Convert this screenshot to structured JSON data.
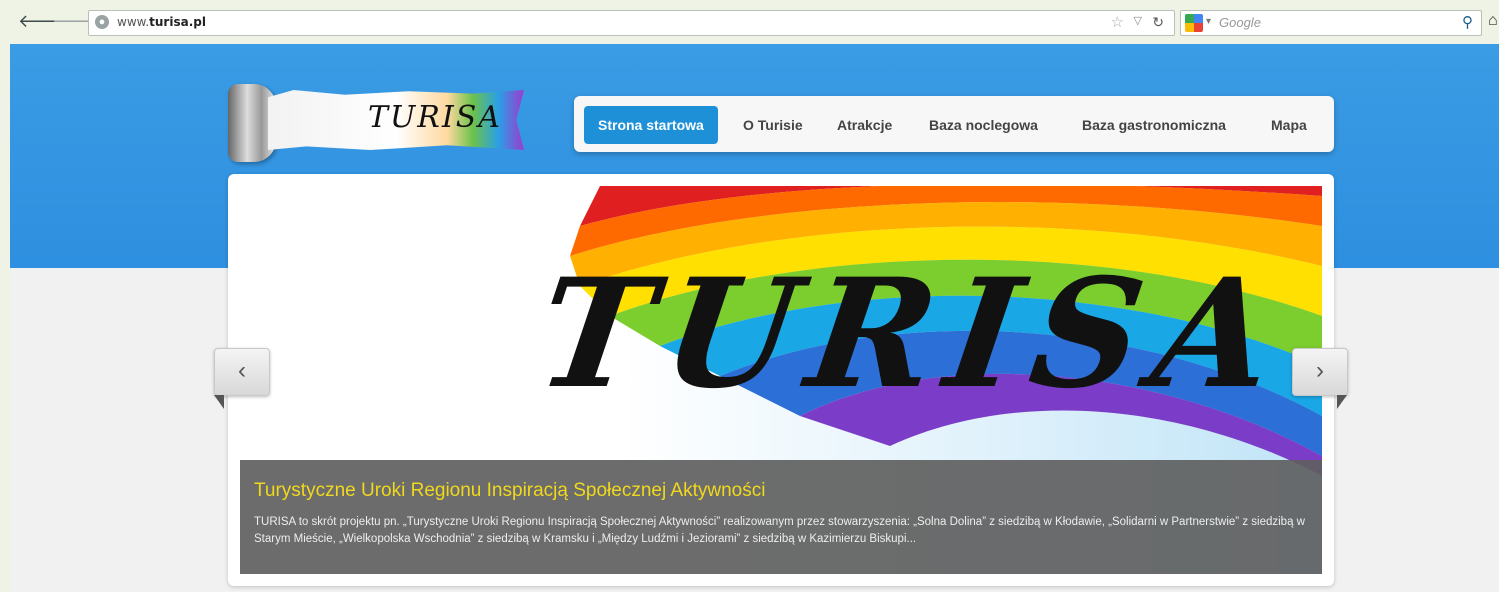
{
  "browser": {
    "url_prefix": "www.",
    "url_domain": "turisa.pl",
    "search_placeholder": "Google",
    "back_glyph": "🡐",
    "forward_glyph": "🡒"
  },
  "site": {
    "logo_text": "TURISA",
    "menu": [
      {
        "label": "Strona startowa",
        "active": true
      },
      {
        "label": "O Turisie",
        "active": false
      },
      {
        "label": "Atrakcje",
        "active": false
      },
      {
        "label": "Baza noclegowa",
        "active": false
      },
      {
        "label": "Baza gastronomiczna",
        "active": false
      },
      {
        "label": "Mapa",
        "active": false
      }
    ]
  },
  "slider": {
    "art_text": "TURISA",
    "caption_title": "Turystyczne Uroki Regionu Inspiracją Społecznej Aktywności",
    "caption_text": "TURISA to skrót projektu pn. „Turystyczne Uroki Regionu Inspiracją Społecznej Aktywności” realizowanym przez stowarzyszenia: „Solna Dolina” z siedzibą w Kłodawie, „Solidarni w Partnerstwie” z siedzibą w Starym Mieście, „Wielkopolska Wschodnia” z siedzibą w Kramsku i „Między Ludźmi i Jeziorami” z siedzibą w Kazimierzu Biskupi...",
    "prev_glyph": "‹",
    "next_glyph": "›"
  },
  "colors": {
    "header_blue": "#2e8fe0",
    "menu_active": "#1e90d8",
    "caption_title": "#f0d81c"
  }
}
